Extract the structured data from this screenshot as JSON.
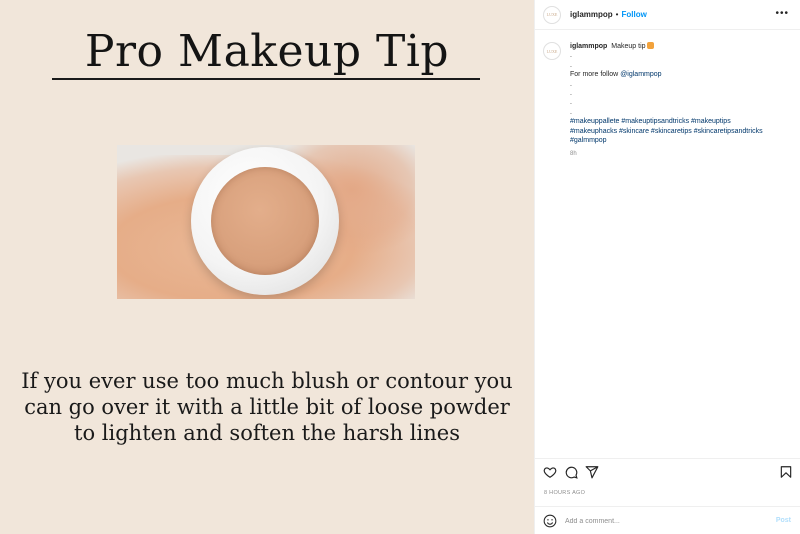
{
  "post": {
    "title": "Pro Makeup Tip",
    "body": "If you ever use too much blush or contour you can go over it with a little bit of loose powder to lighten and soften the harsh lines",
    "photo_subject": "loose powder jar"
  },
  "header": {
    "username": "iglammpop",
    "separator": "•",
    "follow_label": "Follow",
    "more_label": "•••",
    "avatar_text": "LUXE"
  },
  "caption": {
    "username": "iglammpop",
    "text": "Makeup tip",
    "emoji": "face-emoji",
    "dot_lines": [
      ".",
      "."
    ],
    "follow_prefix": "For more follow ",
    "mention": "@iglammpop",
    "dot_lines_2": [
      ".",
      ".",
      ".",
      "."
    ],
    "hashtags_line1": "#makeuppallete #makeuptipsandtricks #makeuptips",
    "hashtags_line2": "#makeuphacks #skincare #skincaretips #skincaretipsandtricks",
    "hashtags_line3": "#galmmpop",
    "age": "8h"
  },
  "actions": {
    "like_icon": "heart-icon",
    "comment_icon": "comment-icon",
    "share_icon": "share-icon",
    "save_icon": "bookmark-icon"
  },
  "timestamp": "8 HOURS AGO",
  "comment": {
    "placeholder": "Add a comment...",
    "post_label": "Post",
    "emoji_icon": "smiley-icon"
  },
  "colors": {
    "image_bg": "#f1e6da",
    "link_blue": "#0095f6",
    "hashtag_blue": "#00376b",
    "post_disabled": "#b2dffc"
  }
}
